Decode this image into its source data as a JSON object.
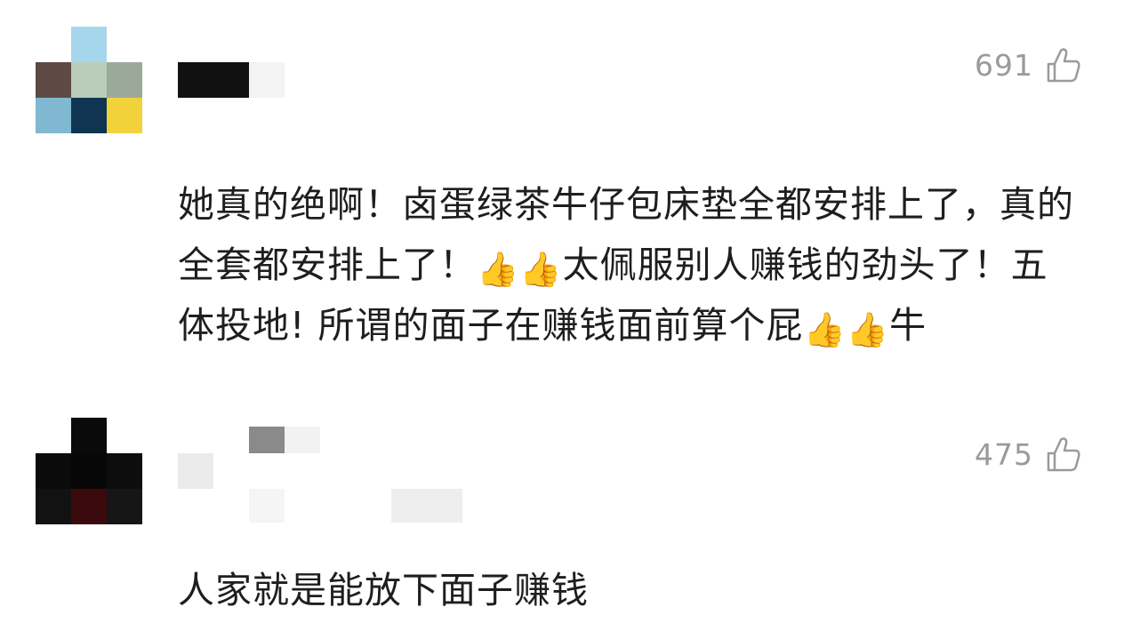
{
  "comments": [
    {
      "likes": "691",
      "text_segments": [
        {
          "type": "text",
          "value": "她真的绝啊！卤蛋绿茶牛仔包床垫全都安排上了，真的全套都安排上了！"
        },
        {
          "type": "emoji",
          "value": "👍"
        },
        {
          "type": "emoji",
          "value": "👍"
        },
        {
          "type": "text",
          "value": "太佩服别人赚钱的劲头了！五体投地! 所谓的面子在赚钱面前算个屁"
        },
        {
          "type": "emoji",
          "value": "👍"
        },
        {
          "type": "emoji",
          "value": "👍"
        },
        {
          "type": "text",
          "value": "牛"
        }
      ]
    },
    {
      "likes": "475",
      "text_segments": [
        {
          "type": "text",
          "value": "人家就是能放下面子赚钱"
        }
      ]
    }
  ],
  "icons": {
    "like": "thumbs-up-outline-icon",
    "emoji": "thumbs-up-emoji"
  },
  "colors": {
    "text": "#1e1e1e",
    "meta": "#9a9a9a",
    "background": "#ffffff"
  }
}
